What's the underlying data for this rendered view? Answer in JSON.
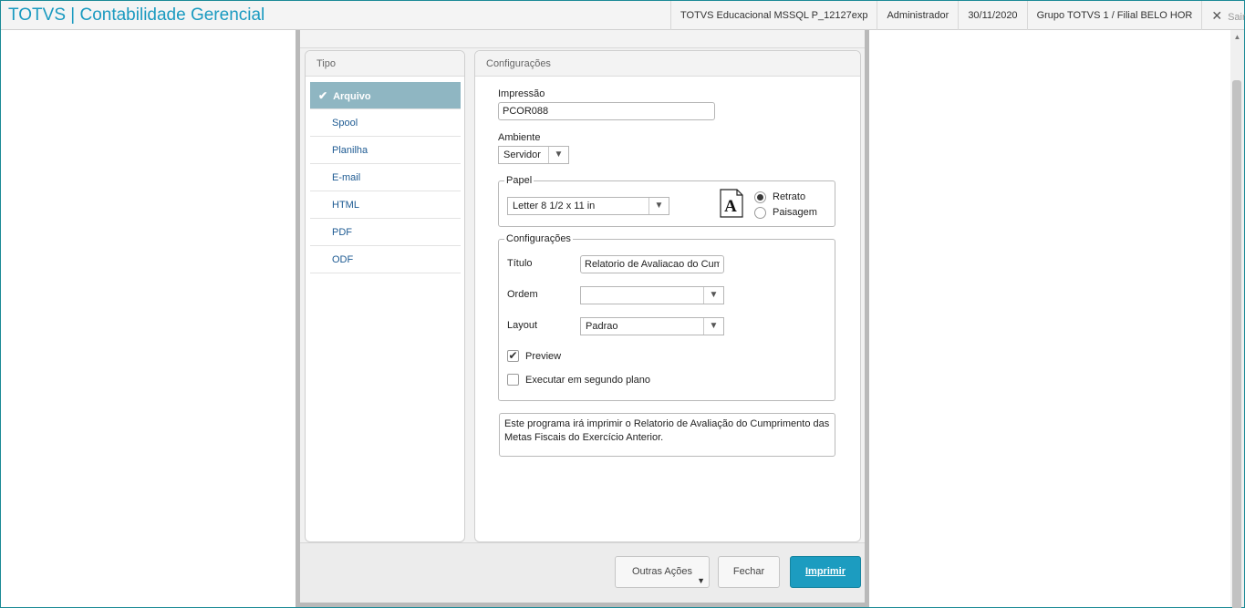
{
  "header": {
    "app_title": "TOTVS | Contabilidade Gerencial",
    "environment": "TOTVS Educacional MSSQL P_12127exp",
    "user": "Administrador",
    "date": "30/11/2020",
    "company": "Grupo TOTVS 1 / Filial BELO HOR",
    "logout_label": "Sair"
  },
  "tipo": {
    "title": "Tipo",
    "items": [
      {
        "label": "Arquivo",
        "selected": true
      },
      {
        "label": "Spool"
      },
      {
        "label": "Planilha"
      },
      {
        "label": "E-mail"
      },
      {
        "label": "HTML"
      },
      {
        "label": "PDF"
      },
      {
        "label": "ODF"
      }
    ]
  },
  "config": {
    "title": "Configurações",
    "impressao_label": "Impressão",
    "impressao_value": "PCOR088",
    "ambiente_label": "Ambiente",
    "ambiente_value": "Servidor",
    "papel": {
      "legend": "Papel",
      "size_value": "Letter 8 1/2 x 11 in",
      "icon_letter": "A",
      "retrato_label": "Retrato",
      "paisagem_label": "Paisagem",
      "orientation": "Retrato"
    },
    "group": {
      "legend": "Configurações",
      "titulo_label": "Título",
      "titulo_value": "Relatorio de Avaliacao do Cump",
      "ordem_label": "Ordem",
      "ordem_value": "",
      "layout_label": "Layout",
      "layout_value": "Padrao",
      "preview_label": "Preview",
      "preview_checked": true,
      "background_label": "Executar em segundo plano",
      "background_checked": false
    },
    "description_line1": "Este programa irá imprimir o Relatorio de Avaliação do Cumprimento das",
    "description_line2": "Metas Fiscais do Exercício Anterior."
  },
  "footer": {
    "outras_label": "Outras Ações",
    "fechar_label": "Fechar",
    "imprimir_label": "Imprimir"
  }
}
